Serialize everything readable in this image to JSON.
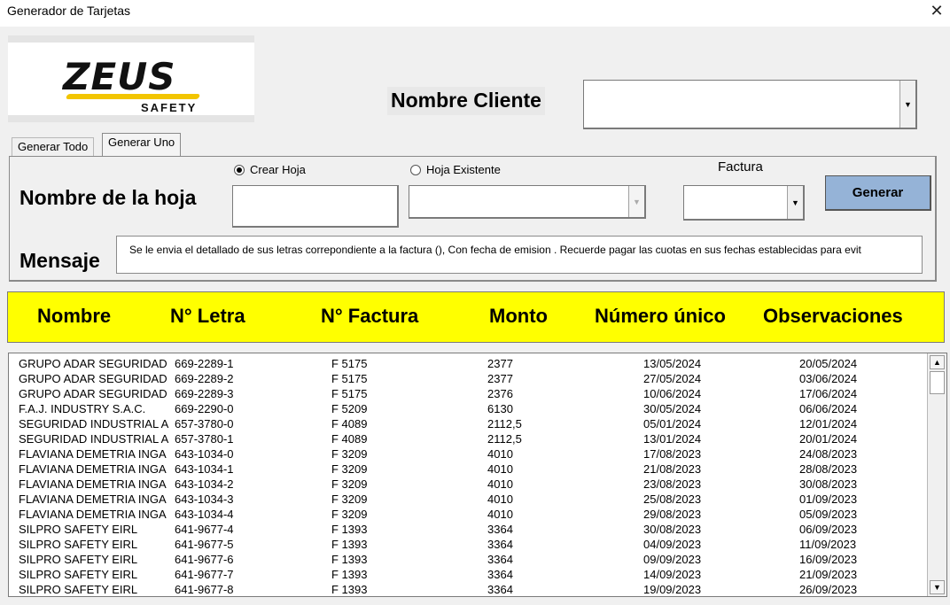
{
  "window": {
    "title": "Generador de Tarjetas",
    "close_label": "✕"
  },
  "logo": {
    "brand": "ZEUS",
    "tagline": "SAFETY"
  },
  "client": {
    "label": "Nombre Cliente",
    "value": ""
  },
  "tabs": [
    {
      "label": "Generar Todo",
      "active": false
    },
    {
      "label": "Generar Uno",
      "active": true
    }
  ],
  "form": {
    "radio_crear": "Crear Hoja",
    "radio_existente": "Hoja Existente",
    "selected_radio": "Crear Hoja",
    "hoja_label": "Nombre de la hoja",
    "hoja_value": "",
    "factura_label": "Factura",
    "factura_value": "",
    "generar_label": "Generar",
    "mensaje_label": "Mensaje",
    "mensaje_value": "Se le envia el detallado de sus letras correpondiente a la factura (), Con fecha de emision . Recuerde pagar las cuotas en sus fechas establecidas  para evit"
  },
  "table": {
    "header_color": "#ffff00",
    "columns": [
      "Nombre",
      "N° Letra",
      "N° Factura",
      "Monto",
      "Número único",
      "Observaciones"
    ],
    "rows": [
      [
        "GRUPO ADAR SEGURIDAD",
        "669-2289-1",
        "F 5175",
        "2377",
        "13/05/2024",
        "20/05/2024"
      ],
      [
        "GRUPO ADAR SEGURIDAD",
        "669-2289-2",
        "F 5175",
        "2377",
        "27/05/2024",
        "03/06/2024"
      ],
      [
        "GRUPO ADAR SEGURIDAD",
        "669-2289-3",
        "F 5175",
        "2376",
        "10/06/2024",
        "17/06/2024"
      ],
      [
        "F.A.J. INDUSTRY S.A.C.",
        "669-2290-0",
        "F 5209",
        "6130",
        "30/05/2024",
        "06/06/2024"
      ],
      [
        "SEGURIDAD INDUSTRIAL A",
        "657-3780-0",
        "F 4089",
        "2112,5",
        "05/01/2024",
        "12/01/2024"
      ],
      [
        "SEGURIDAD INDUSTRIAL A",
        "657-3780-1",
        "F 4089",
        "2112,5",
        "13/01/2024",
        "20/01/2024"
      ],
      [
        "FLAVIANA DEMETRIA INGA",
        "643-1034-0",
        "F 3209",
        "4010",
        "17/08/2023",
        "24/08/2023"
      ],
      [
        "FLAVIANA DEMETRIA INGA",
        "643-1034-1",
        "F 3209",
        "4010",
        "21/08/2023",
        "28/08/2023"
      ],
      [
        "FLAVIANA DEMETRIA INGA",
        "643-1034-2",
        "F 3209",
        "4010",
        "23/08/2023",
        "30/08/2023"
      ],
      [
        "FLAVIANA DEMETRIA INGA",
        "643-1034-3",
        "F 3209",
        "4010",
        "25/08/2023",
        "01/09/2023"
      ],
      [
        "FLAVIANA DEMETRIA INGA",
        "643-1034-4",
        "F 3209",
        "4010",
        "29/08/2023",
        "05/09/2023"
      ],
      [
        "SILPRO SAFETY EIRL",
        "641-9677-4",
        "F 1393",
        "3364",
        "30/08/2023",
        "06/09/2023"
      ],
      [
        "SILPRO SAFETY EIRL",
        "641-9677-5",
        "F 1393",
        "3364",
        "04/09/2023",
        "11/09/2023"
      ],
      [
        "SILPRO SAFETY EIRL",
        "641-9677-6",
        "F 1393",
        "3364",
        "09/09/2023",
        "16/09/2023"
      ],
      [
        "SILPRO SAFETY EIRL",
        "641-9677-7",
        "F 1393",
        "3364",
        "14/09/2023",
        "21/09/2023"
      ],
      [
        "SILPRO SAFETY EIRL",
        "641-9677-8",
        "F 1393",
        "3364",
        "19/09/2023",
        "26/09/2023"
      ]
    ]
  },
  "icons": {
    "dropdown": "▼",
    "scroll_up": "▲",
    "scroll_down": "▼"
  }
}
